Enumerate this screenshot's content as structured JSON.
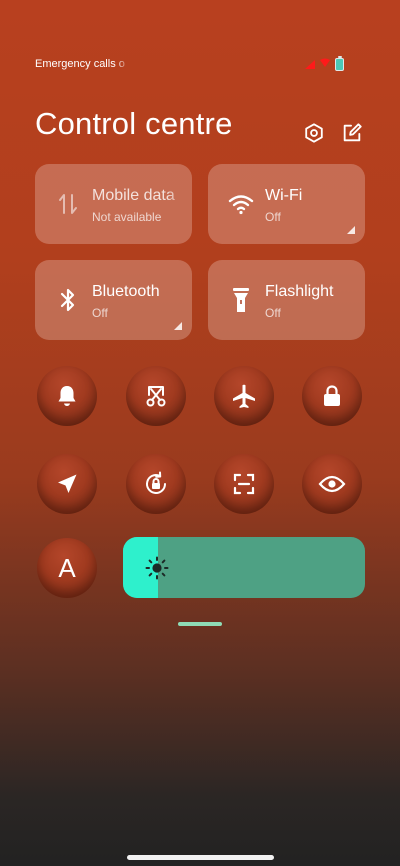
{
  "status_bar": {
    "carrier_text": "Emergency calls o",
    "signal_color": "#ff1a1a",
    "battery_color": "#4cc9b5"
  },
  "header": {
    "title": "Control centre",
    "icons": [
      "settings-icon",
      "edit-icon"
    ]
  },
  "tiles": [
    {
      "label": "Mobile data",
      "status": "Not available",
      "icon": "mobile-data-icon",
      "enabled": false
    },
    {
      "label": "Wi-Fi",
      "status": "Off",
      "icon": "wifi-icon",
      "enabled": false
    },
    {
      "label": "Bluetooth",
      "status": "Off",
      "icon": "bluetooth-icon",
      "enabled": false
    },
    {
      "label": "Flashlight",
      "status": "Off",
      "icon": "flashlight-icon",
      "enabled": false
    }
  ],
  "toggles": [
    {
      "name": "notification-toggle",
      "icon": "bell-icon"
    },
    {
      "name": "screenshot-toggle",
      "icon": "scissors-icon"
    },
    {
      "name": "airplane-mode-toggle",
      "icon": "airplane-icon"
    },
    {
      "name": "lock-screen-toggle",
      "icon": "lock-icon"
    },
    {
      "name": "location-toggle",
      "icon": "location-arrow-icon"
    },
    {
      "name": "rotation-lock-toggle",
      "icon": "rotation-lock-icon"
    },
    {
      "name": "scanner-toggle",
      "icon": "scan-icon"
    },
    {
      "name": "reading-mode-toggle",
      "icon": "eye-icon"
    },
    {
      "name": "auto-brightness-toggle",
      "icon": "letter-a-icon",
      "glyph": "A"
    }
  ],
  "brightness": {
    "level": 0.145,
    "fill_color": "#2ef0cc",
    "track_color": "#4ea184",
    "icon": "sun-icon"
  },
  "colors": {
    "tile_background": "rgba(255,240,235,0.26)",
    "pager_indicator": "#8fdcb6"
  }
}
